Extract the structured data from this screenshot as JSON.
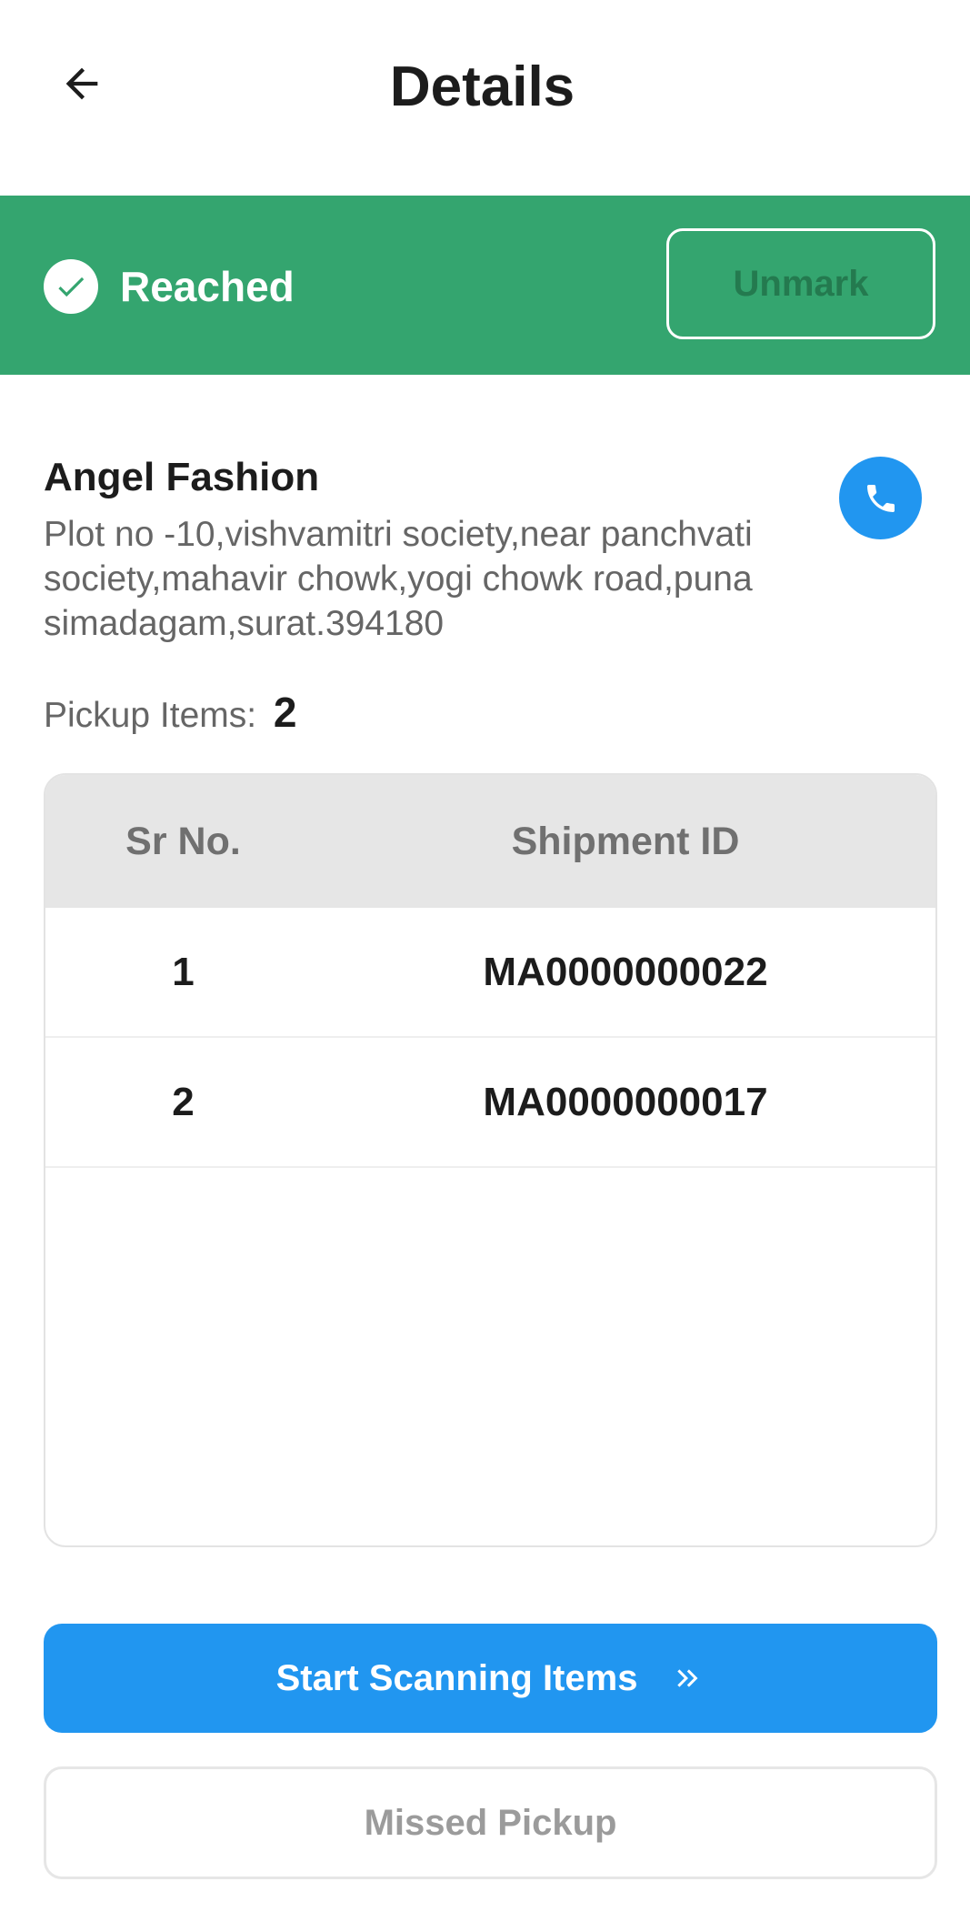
{
  "header": {
    "title": "Details",
    "back_icon": "arrow-left-icon"
  },
  "status": {
    "label": "Reached",
    "icon": "check-circle-icon",
    "unmark_label": "Unmark",
    "banner_color": "#34a56f"
  },
  "customer": {
    "name": "Angel Fashion",
    "address": "Plot no -10,vishvamitri society,near panchvati society,mahavir chowk,yogi chowk road,puna simadagam,surat.394180",
    "call_icon": "phone-icon"
  },
  "pickup": {
    "label": "Pickup Items:",
    "count": "2"
  },
  "table": {
    "columns": [
      "Sr No.",
      "Shipment ID"
    ],
    "rows": [
      {
        "sr": "1",
        "shipment_id": "MA0000000022"
      },
      {
        "sr": "2",
        "shipment_id": "MA0000000017"
      }
    ]
  },
  "actions": {
    "scan_label": "Start Scanning Items",
    "scan_icon": "double-chevron-right-icon",
    "missed_label": "Missed Pickup",
    "primary_color": "#2196f0"
  }
}
